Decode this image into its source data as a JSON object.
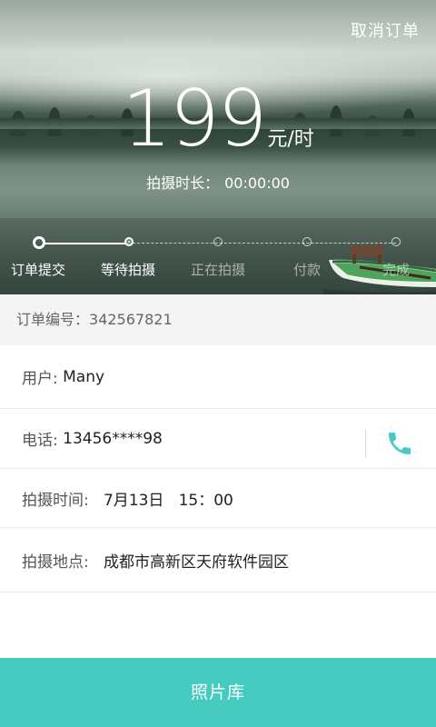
{
  "header": {
    "cancel_label": "取消订单",
    "price": "199",
    "price_unit": "元/时",
    "duration_label": "拍摄时长：",
    "duration_value": "00:00:00"
  },
  "steps": [
    {
      "label": "订单提交",
      "state": "completed"
    },
    {
      "label": "等待拍摄",
      "state": "current"
    },
    {
      "label": "正在拍摄",
      "state": "upcoming"
    },
    {
      "label": "付款",
      "state": "upcoming"
    },
    {
      "label": "完成",
      "state": "upcoming"
    }
  ],
  "order": {
    "label": "订单编号：",
    "number": "342567821"
  },
  "details": {
    "user_label": "用户:",
    "user_value": "Many",
    "phone_label": "电话:",
    "phone_value": "13456****98",
    "time_label": "拍摄时间:",
    "time_value": "7月13日   15：00",
    "place_label": "拍摄地点:",
    "place_value": "成都市高新区天府软件园区"
  },
  "footer": {
    "gallery_label": "照片库"
  },
  "icons": {
    "phone": "phone-icon",
    "boat": "boat-image"
  },
  "colors": {
    "accent": "#46cbc0"
  }
}
